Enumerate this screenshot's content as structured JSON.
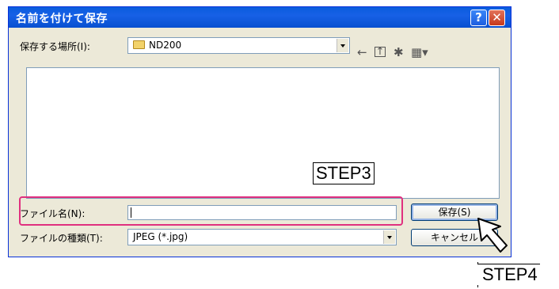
{
  "dialog": {
    "title": "名前を付けて保存",
    "help_glyph": "?",
    "close_glyph": "✕"
  },
  "save_in": {
    "label": "保存する場所(I):",
    "value": "ND200"
  },
  "toolbar_icons": [
    "back-arrow-icon",
    "up-folder-icon",
    "new-folder-icon",
    "view-menu-icon"
  ],
  "filename": {
    "label": "ファイル名(N):",
    "value": ""
  },
  "filetype": {
    "label": "ファイルの種類(T):",
    "value": "JPEG (*.jpg)"
  },
  "buttons": {
    "save": "保存(S)",
    "cancel": "キャンセル"
  },
  "annotations": {
    "step3": "STEP3",
    "step4": "STEP4"
  },
  "colors": {
    "titlebar": "#0a5ddd",
    "highlight": "#e0307f"
  }
}
